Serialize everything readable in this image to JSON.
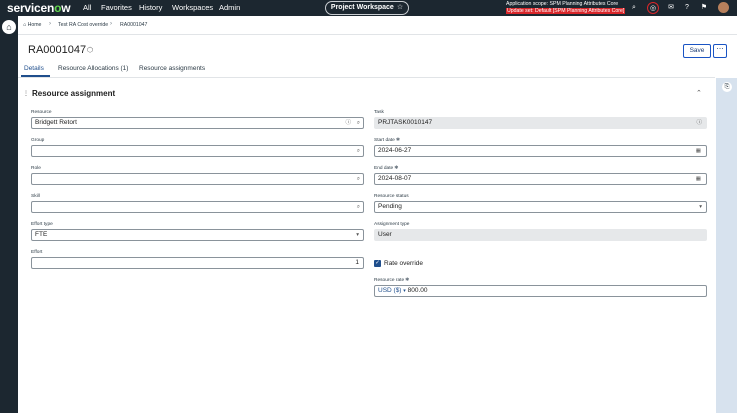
{
  "topnav": {
    "logo_prefix": "servicen",
    "logo_o": "o",
    "logo_suffix": "w",
    "links": [
      "All",
      "Favorites",
      "History",
      "Workspaces",
      "Admin"
    ],
    "workspace_label": "Project Workspace",
    "scope_line1": "Application scope: SPM Planning Attributes Core",
    "scope_line2": "Update set: Default [SPM Planning Attributes Core]"
  },
  "breadcrumb": {
    "home": "Home",
    "item1": "Test RA Cost override",
    "item2": "RA0001047"
  },
  "record": {
    "title": "RA0001047",
    "save_label": "Save",
    "more_label": "⋯"
  },
  "tabs": [
    "Details",
    "Resource Allocations (1)",
    "Resource assignments"
  ],
  "section": {
    "title": "Resource assignment"
  },
  "fields": {
    "resource": {
      "label": "Resource",
      "value": "Bridgett Retort"
    },
    "group": {
      "label": "Group",
      "value": ""
    },
    "role": {
      "label": "Role",
      "value": ""
    },
    "skill": {
      "label": "Skill",
      "value": ""
    },
    "effort_type": {
      "label": "Effort type",
      "value": "FTE"
    },
    "effort": {
      "label": "Effort",
      "value": "1"
    },
    "task": {
      "label": "Task",
      "value": "PRJTASK0010147"
    },
    "start_date": {
      "label": "Start date",
      "value": "2024-06-27"
    },
    "end_date": {
      "label": "End date",
      "value": "2024-08-07"
    },
    "resource_status": {
      "label": "Resource status",
      "value": "Pending"
    },
    "assignment_type": {
      "label": "Assignment type",
      "value": "User"
    },
    "rate_override": {
      "label": "Rate override",
      "checked": true
    },
    "resource_rate": {
      "label": "Resource rate",
      "currency": "USD ($)",
      "value": "800.00"
    }
  },
  "colors": {
    "nav_bg": "#1c2730",
    "accent": "#1f4e8c",
    "warning": "#d9262a",
    "side_strip": "#d7e2ee"
  }
}
